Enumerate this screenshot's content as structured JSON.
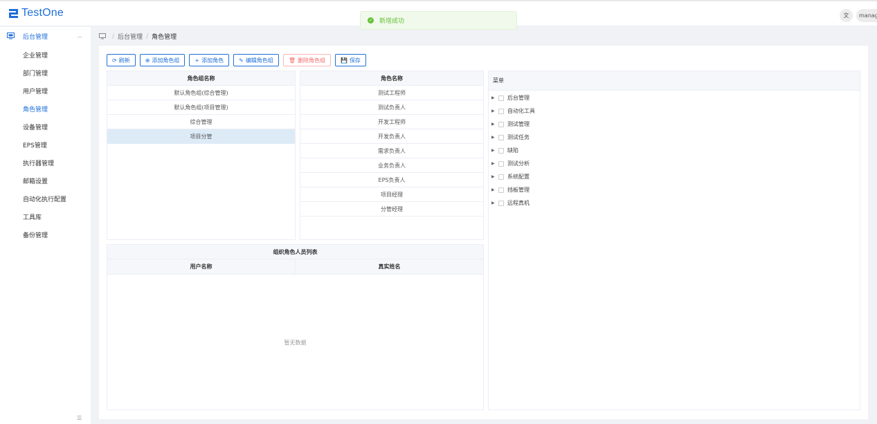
{
  "app": {
    "logo_text": "TestOne",
    "lang_icon": "translate-icon",
    "user_label": "manager"
  },
  "toast": {
    "text": "新增成功",
    "color": "#67c23a"
  },
  "sidebar": {
    "parent_label": "后台管理",
    "items": [
      "企业管理",
      "部门管理",
      "用户管理",
      "角色管理",
      "设备管理",
      "EPS管理",
      "执行器管理",
      "邮箱设置",
      "自动化执行配置",
      "工具库",
      "备份管理"
    ],
    "active_index": 3
  },
  "breadcrumb": {
    "level1": "后台管理",
    "current": "角色管理"
  },
  "toolbar": {
    "refresh": "刷新",
    "add_group": "添加角色组",
    "add_role": "添加角色",
    "edit_group": "编辑角色组",
    "delete_group": "删除角色组",
    "save": "保存"
  },
  "group_table": {
    "header": "角色组名称",
    "rows": [
      "默认角色组(综合管理)",
      "默认角色组(项目管理)",
      "综合管理",
      "项目分管"
    ],
    "selected_index": 3
  },
  "role_table": {
    "header": "角色名称",
    "rows": [
      "测试工程师",
      "测试负责人",
      "开发工程师",
      "开发负责人",
      "需求负责人",
      "业务负责人",
      "EPS负责人",
      "项目经理",
      "分管经理"
    ]
  },
  "menu_panel": {
    "header": "菜单",
    "nodes": [
      "后台管理",
      "自动化工具",
      "测试管理",
      "测试任务",
      "缺陷",
      "测试分析",
      "系统配置",
      "挡板管理",
      "远程真机"
    ]
  },
  "users_table": {
    "title": "组织角色人员列表",
    "col_username": "用户名称",
    "col_realname": "真实姓名",
    "empty_text": "暂无数据"
  },
  "colors": {
    "primary": "#1e6fd9",
    "danger": "#f56c6c",
    "success": "#67c23a",
    "selected_row": "#ddebf7"
  }
}
